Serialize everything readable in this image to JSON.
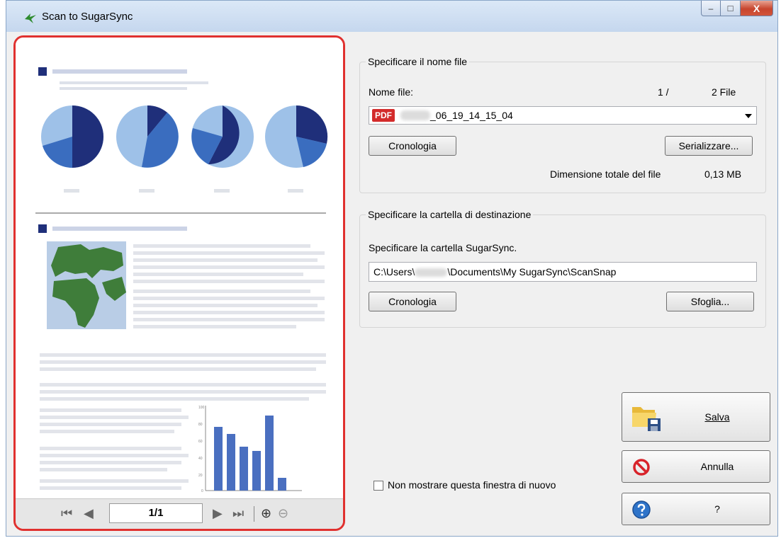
{
  "window": {
    "title": "Scan to SugarSync",
    "min_glyph": "–",
    "max_glyph": "□",
    "close_glyph": "X"
  },
  "colors": {
    "accent_red": "#e0312f",
    "pie_dark": "#1f2f7a",
    "pie_mid": "#3a6dbf",
    "pie_light": "#9ec1e8",
    "map_green": "#3f7d3a"
  },
  "preview": {
    "page_indicator": "1/1",
    "nav": {
      "first": "⏮",
      "prev": "◀",
      "next": "▶",
      "last": "⏭",
      "zoom_in": "⊕",
      "zoom_out": "⊖"
    },
    "thumb_chart_ticks": [
      "100",
      "80",
      "60",
      "40",
      "20",
      "0"
    ]
  },
  "file_group": {
    "legend": "Specificare il nome file",
    "file_label": "Nome file:",
    "counter_current": "1 /",
    "counter_total": "2 File",
    "file_name": "_06_19_14_15_04",
    "file_icon_text": "PDF",
    "history_button": "Cronologia",
    "serialize_button": "Serializzare...",
    "size_label": "Dimensione totale del file",
    "size_value": "0,13  MB"
  },
  "folder_group": {
    "legend": "Specificare la cartella di destinazione",
    "prompt": "Specificare la cartella SugarSync.",
    "path_start": "C:\\Users\\",
    "path_end": "\\Documents\\My SugarSync\\ScanSnap",
    "history_button": "Cronologia",
    "browse_button": "Sfoglia..."
  },
  "actions": {
    "save": "Salva",
    "cancel": "Annulla",
    "help": "?"
  },
  "footer": {
    "dont_show_label": "Non mostrare questa finestra di nuovo"
  }
}
